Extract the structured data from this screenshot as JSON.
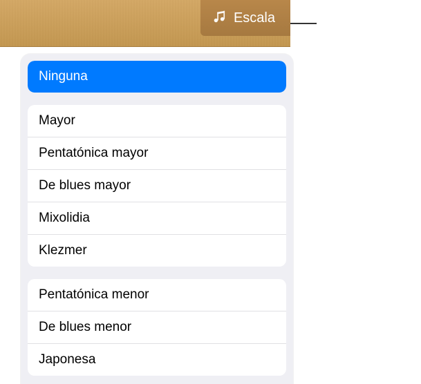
{
  "header": {
    "button_label": "Escala"
  },
  "popover": {
    "selected": "Ninguna",
    "group1": [
      "Mayor",
      "Pentatónica mayor",
      "De blues mayor",
      "Mixolidia",
      "Klezmer"
    ],
    "group2": [
      "Pentatónica menor",
      "De blues menor",
      "Japonesa"
    ]
  }
}
